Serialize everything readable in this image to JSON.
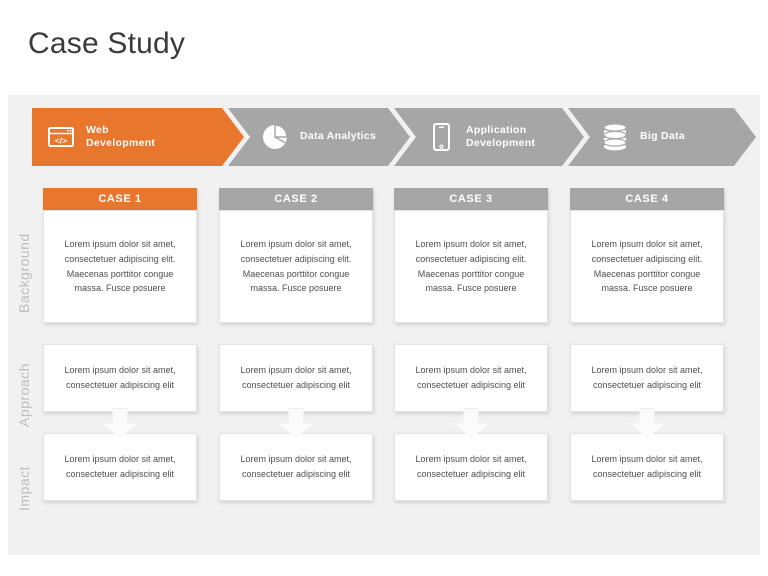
{
  "slide": {
    "title": "Case Study",
    "colors": {
      "accent": "#e8762c",
      "muted": "#a6a6a6",
      "panel": "#f1f1f1",
      "card": "#ffffff",
      "label": "#bdbdbd",
      "title_text": "#3b3b3b"
    }
  },
  "process_bar": {
    "steps": [
      {
        "label": "Web\nDevelopment",
        "icon": "code-window-icon",
        "state": "active"
      },
      {
        "label": "Data Analytics",
        "icon": "pie-chart-icon",
        "state": "inactive"
      },
      {
        "label": "Application\nDevelopment",
        "icon": "smartphone-icon",
        "state": "inactive"
      },
      {
        "label": "Big Data",
        "icon": "database-icon",
        "state": "inactive"
      }
    ]
  },
  "row_labels": [
    {
      "label": "Background"
    },
    {
      "label": "Approach"
    },
    {
      "label": "Impact"
    }
  ],
  "cases": [
    {
      "header": "CASE 1",
      "state": "active",
      "background": "Lorem ipsum dolor sit amet, consectetuer adipiscing elit. Maecenas porttitor congue massa. Fusce posuere",
      "approach": "Lorem ipsum dolor sit amet, consectetuer adipiscing elit",
      "impact": "Lorem ipsum dolor sit amet, consectetuer adipiscing elit"
    },
    {
      "header": "CASE 2",
      "state": "inactive",
      "background": "Lorem ipsum dolor sit amet, consectetuer adipiscing elit. Maecenas porttitor congue massa. Fusce posuere",
      "approach": "Lorem ipsum dolor sit amet, consectetuer adipiscing elit",
      "impact": "Lorem ipsum dolor sit amet, consectetuer adipiscing elit"
    },
    {
      "header": "CASE 3",
      "state": "inactive",
      "background": "Lorem ipsum dolor sit amet, consectetuer adipiscing elit. Maecenas porttitor congue massa. Fusce posuere",
      "approach": "Lorem ipsum dolor sit amet, consectetuer adipiscing elit",
      "impact": "Lorem ipsum dolor sit amet, consectetuer adipiscing elit"
    },
    {
      "header": "CASE 4",
      "state": "inactive",
      "background": "Lorem ipsum dolor sit amet, consectetuer adipiscing elit. Maecenas porttitor congue massa. Fusce posuere",
      "approach": "Lorem ipsum dolor sit amet, consectetuer adipiscing elit",
      "impact": "Lorem ipsum dolor sit amet, consectetuer adipiscing elit"
    }
  ]
}
